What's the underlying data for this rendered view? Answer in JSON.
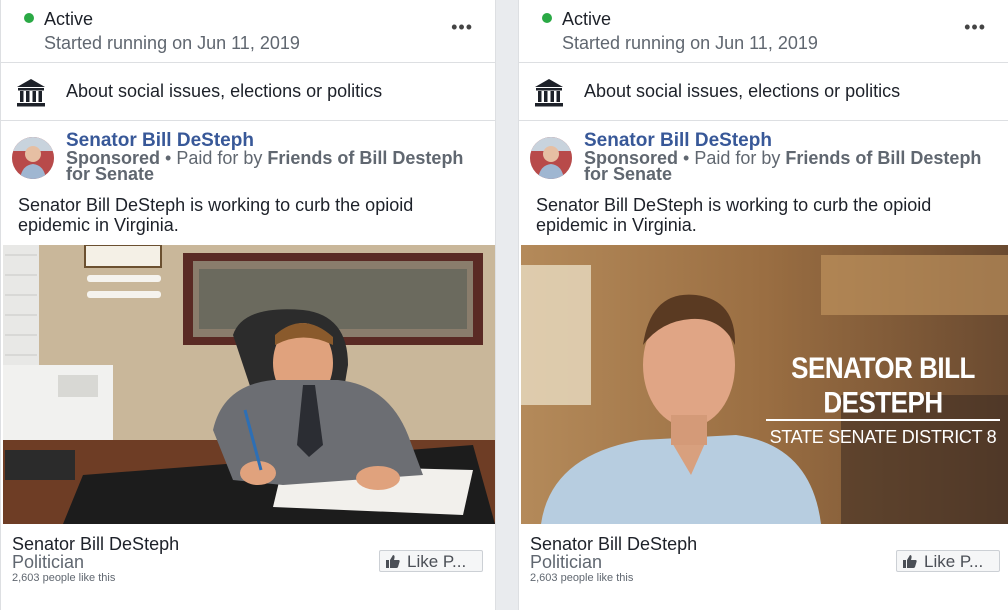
{
  "cards": [
    {
      "status": {
        "label": "Active",
        "started": "Started running on Jun 11, 2019",
        "more_icon": "more-horizontal-icon"
      },
      "topic": {
        "icon": "government-building-icon",
        "label": "About social issues, elections or politics"
      },
      "post": {
        "page_name": "Senator Bill DeSteph",
        "sponsored": "Sponsored",
        "paid_for_prefix": "• Paid for by",
        "paid_for_by": "Friends of Bill Desteph for Senate",
        "text": "Senator Bill DeSteph is working to curb the opioid epidemic in Virginia."
      },
      "footer": {
        "page_name": "Senator Bill DeSteph",
        "category": "Politician",
        "likes": "2,603 people like this",
        "like_button": "Like P...",
        "like_icon": "thumbs-up-icon"
      }
    },
    {
      "status": {
        "label": "Active",
        "started": "Started running on Jun 11, 2019",
        "more_icon": "more-horizontal-icon"
      },
      "topic": {
        "icon": "government-building-icon",
        "label": "About social issues, elections or politics"
      },
      "post": {
        "page_name": "Senator Bill DeSteph",
        "sponsored": "Sponsored",
        "paid_for_prefix": "• Paid for by",
        "paid_for_by": "Friends of Bill Desteph for Senate",
        "text": "Senator Bill DeSteph is working to curb the opioid epidemic in Virginia.",
        "video_title": "SENATOR BILL DESTEPH",
        "video_subtitle": "STATE SENATE DISTRICT 8"
      },
      "footer": {
        "page_name": "Senator Bill DeSteph",
        "category": "Politician",
        "likes": "2,603 people like this",
        "like_button": "Like P...",
        "like_icon": "thumbs-up-icon"
      }
    }
  ],
  "colors": {
    "active_dot": "#2aa945",
    "link": "#385898",
    "secondary_text": "#606770"
  }
}
